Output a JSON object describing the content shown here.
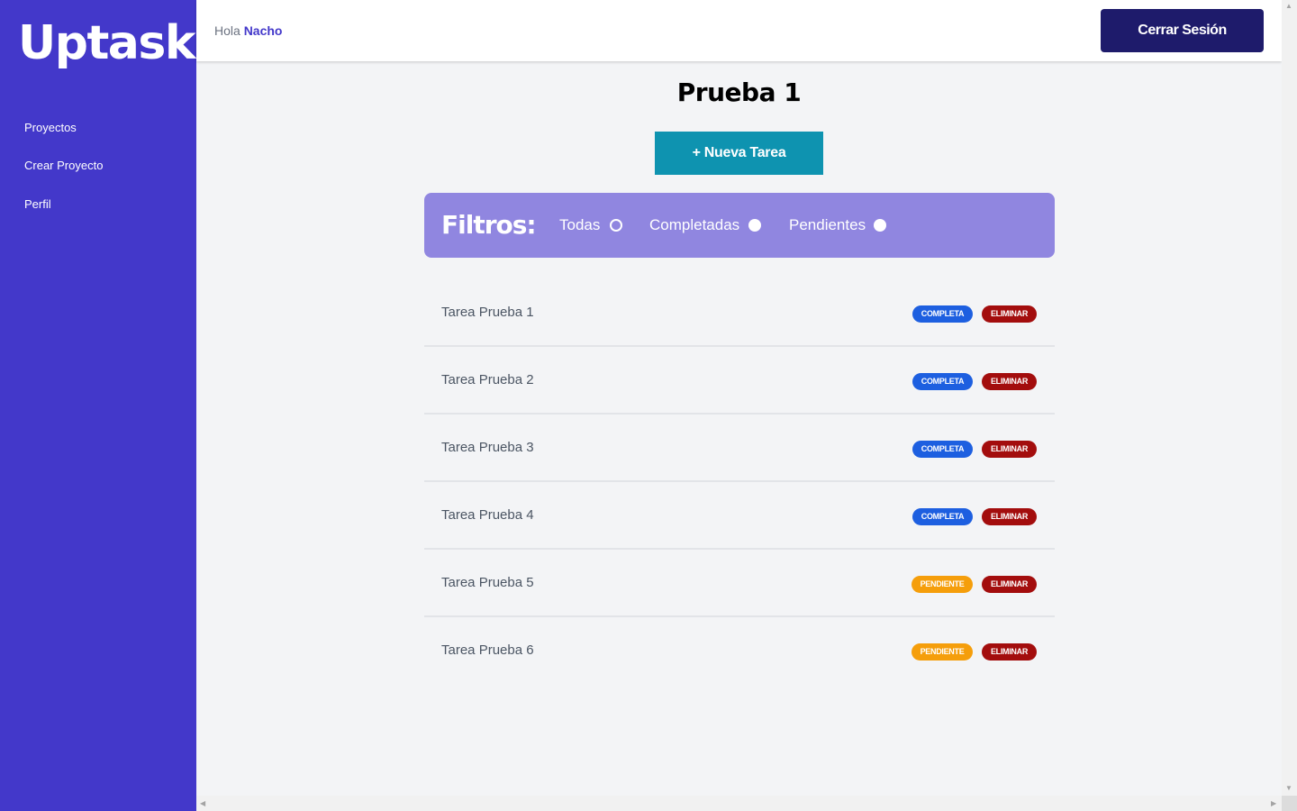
{
  "sidebar": {
    "logo": "Uptask",
    "items": [
      {
        "label": "Proyectos"
      },
      {
        "label": "Crear Proyecto"
      },
      {
        "label": "Perfil"
      }
    ]
  },
  "header": {
    "greeting_prefix": "Hola",
    "username": "Nacho",
    "logout_label": "Cerrar Sesión"
  },
  "project": {
    "title": "Prueba 1",
    "new_task_label": "+ Nueva Tarea"
  },
  "filters": {
    "title": "Filtros:",
    "options": [
      {
        "label": "Todas",
        "selected": true
      },
      {
        "label": "Completadas",
        "selected": false
      },
      {
        "label": "Pendientes",
        "selected": false
      }
    ]
  },
  "tasks": [
    {
      "name": "Tarea Prueba 1",
      "status": "Completa",
      "delete": "Eliminar"
    },
    {
      "name": "Tarea Prueba 2",
      "status": "Completa",
      "delete": "Eliminar"
    },
    {
      "name": "Tarea Prueba 3",
      "status": "Completa",
      "delete": "Eliminar"
    },
    {
      "name": "Tarea Prueba 4",
      "status": "Completa",
      "delete": "Eliminar"
    },
    {
      "name": "Tarea Prueba 5",
      "status": "Pendiente",
      "delete": "Eliminar"
    },
    {
      "name": "Tarea Prueba 6",
      "status": "Pendiente",
      "delete": "Eliminar"
    }
  ],
  "colors": {
    "sidebar": "#4338ca",
    "logout_button": "#1e1b6b",
    "new_task_button": "#0e93b0",
    "filters_panel": "#9086e0",
    "badge_complete": "#1d5fe0",
    "badge_pending": "#f59e0b",
    "badge_delete": "#a30d0d"
  },
  "icons": {
    "scroll_left": "scroll-left-arrow-icon",
    "scroll_right": "scroll-right-arrow-icon",
    "scroll_up": "scroll-up-arrow-icon",
    "scroll_down": "scroll-down-arrow-icon"
  }
}
